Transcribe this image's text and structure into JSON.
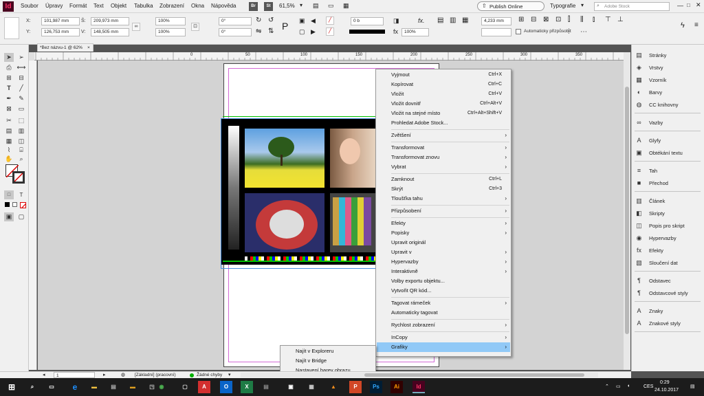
{
  "app": {
    "logo": "Id",
    "zoom": "61,5%",
    "br": "Br",
    "st": "St"
  },
  "menubar": {
    "items": [
      "Soubor",
      "Úpravy",
      "Formát",
      "Text",
      "Objekt",
      "Tabulka",
      "Zobrazení",
      "Okna",
      "Nápověda"
    ],
    "publish": "Publish Online",
    "workspace": "Typografie",
    "search_placeholder": "Adobe Stock"
  },
  "control": {
    "x": "101,987 mm",
    "y": "126,753 mm",
    "w": "209,973 mm",
    "h": "148,505 mm",
    "x_label": "X:",
    "y_label": "Y:",
    "w_label": "Š:",
    "h_label": "V:",
    "scale_x": "100%",
    "scale_y": "100%",
    "rotate": "0°",
    "shear": "0°",
    "stroke": "0 b",
    "opacity": "100%",
    "offset": "4,233 mm",
    "autofit": "Automaticky přizpůsobit"
  },
  "document_tab": {
    "title": "*Bez názvu-1 @ 62%",
    "close": "×"
  },
  "ruler": {
    "marks": [
      "0",
      "50",
      "100",
      "150",
      "200",
      "250",
      "300",
      "350"
    ]
  },
  "right_panel": {
    "groups": [
      [
        {
          "icon": "pages-icon",
          "glyph": "▤",
          "label": "Stránky"
        },
        {
          "icon": "layers-icon",
          "glyph": "◈",
          "label": "Vrstvy"
        },
        {
          "icon": "swatch-icon",
          "glyph": "▦",
          "label": "Vzorník"
        },
        {
          "icon": "color-icon",
          "glyph": "◐",
          "label": "Barvy"
        },
        {
          "icon": "cc-libraries-icon",
          "glyph": "◍",
          "label": "CC knihovny"
        }
      ],
      [
        {
          "icon": "links-icon",
          "glyph": "∞",
          "label": "Vazby"
        }
      ],
      [
        {
          "icon": "glyphs-icon",
          "glyph": "A",
          "label": "Glyfy"
        },
        {
          "icon": "text-wrap-icon",
          "glyph": "▣",
          "label": "Obtékání textu"
        }
      ],
      [
        {
          "icon": "stroke-icon",
          "glyph": "≡",
          "label": "Tah"
        },
        {
          "icon": "gradient-icon",
          "glyph": "■",
          "label": "Přechod"
        }
      ],
      [
        {
          "icon": "article-icon",
          "glyph": "▥",
          "label": "Článek"
        },
        {
          "icon": "scripts-icon",
          "glyph": "◧",
          "label": "Skripty"
        },
        {
          "icon": "script-label-icon",
          "glyph": "◫",
          "label": "Popis pro skript"
        },
        {
          "icon": "hyperlinks-icon",
          "glyph": "◉",
          "label": "Hypervazby"
        },
        {
          "icon": "effects-icon",
          "glyph": "fx",
          "label": "Efekty"
        },
        {
          "icon": "merge-icon",
          "glyph": "▧",
          "label": "Sloučení dat"
        }
      ],
      [
        {
          "icon": "paragraph-icon",
          "glyph": "¶",
          "label": "Odstavec"
        },
        {
          "icon": "paragraph-styles-icon",
          "glyph": "¶",
          "label": "Odstavcové styly"
        }
      ],
      [
        {
          "icon": "character-icon",
          "glyph": "A",
          "label": "Znaky"
        },
        {
          "icon": "character-styles-icon",
          "glyph": "A",
          "label": "Znakové styly"
        }
      ]
    ]
  },
  "context_menu": {
    "items": [
      {
        "label": "Vyjmout",
        "shortcut": "Ctrl+X",
        "arrow": ""
      },
      {
        "label": "Kopírovat",
        "shortcut": "Ctrl+C",
        "arrow": ""
      },
      {
        "label": "Vložit",
        "shortcut": "Ctrl+V",
        "arrow": ""
      },
      {
        "label": "Vložit dovnitř",
        "shortcut": "Ctrl+Alt+V",
        "arrow": ""
      },
      {
        "label": "Vložit na stejné místo",
        "shortcut": "Ctrl+Alt+Shift+V",
        "arrow": ""
      },
      {
        "label": "Prohledat Adobe Stock...",
        "shortcut": "",
        "arrow": ""
      },
      {
        "sep": true
      },
      {
        "label": "Zvětšení",
        "shortcut": "",
        "arrow": "›"
      },
      {
        "sep": true
      },
      {
        "label": "Transformovat",
        "shortcut": "",
        "arrow": "›"
      },
      {
        "label": "Transformovat znovu",
        "shortcut": "",
        "arrow": "›"
      },
      {
        "label": "Vybrat",
        "shortcut": "",
        "arrow": "›"
      },
      {
        "sep": true
      },
      {
        "label": "Zamknout",
        "shortcut": "Ctrl+L",
        "arrow": ""
      },
      {
        "label": "Skrýt",
        "shortcut": "Ctrl+3",
        "arrow": ""
      },
      {
        "label": "Tloušťka tahu",
        "shortcut": "",
        "arrow": "›"
      },
      {
        "sep": true
      },
      {
        "label": "Přizpůsobení",
        "shortcut": "",
        "arrow": "›"
      },
      {
        "sep": true
      },
      {
        "label": "Efekty",
        "shortcut": "",
        "arrow": "›"
      },
      {
        "label": "Popisky",
        "shortcut": "",
        "arrow": "›"
      },
      {
        "label": "Upravit originál",
        "shortcut": "",
        "arrow": ""
      },
      {
        "label": "Upravit v",
        "shortcut": "",
        "arrow": "›"
      },
      {
        "label": "Hypervazby",
        "shortcut": "",
        "arrow": "›"
      },
      {
        "label": "Interaktivně",
        "shortcut": "",
        "arrow": "›"
      },
      {
        "label": "Volby exportu objektu...",
        "shortcut": "",
        "arrow": ""
      },
      {
        "label": "Vytvořit QR kód...",
        "shortcut": "",
        "arrow": ""
      },
      {
        "sep": true
      },
      {
        "label": "Tagovat rámeček",
        "shortcut": "",
        "arrow": "›"
      },
      {
        "label": "Automaticky tagovat",
        "shortcut": "",
        "arrow": ""
      },
      {
        "sep": true
      },
      {
        "label": "Rychlost zobrazení",
        "shortcut": "",
        "arrow": "›"
      },
      {
        "sep": true
      },
      {
        "label": "InCopy",
        "shortcut": "",
        "arrow": "›"
      },
      {
        "label": "Grafiky",
        "shortcut": "",
        "arrow": "›",
        "selected": true
      }
    ]
  },
  "submenu": {
    "items": [
      "Najít v Exploreru",
      "Najít v Bridge",
      "Nastavení barev obrazu..."
    ]
  },
  "status": {
    "page": "1",
    "master": "[Základní] (pracovní)",
    "preflight": "Žádné chyby"
  },
  "taskbar": {
    "time": "0:29",
    "date": "24.10.2017",
    "lang": "CES"
  },
  "colors": {
    "accent": "#91c9f7",
    "indesign": "#49021f",
    "indesign_text": "#ff3366",
    "frame": "#4a90e2",
    "green": "#00c000"
  }
}
